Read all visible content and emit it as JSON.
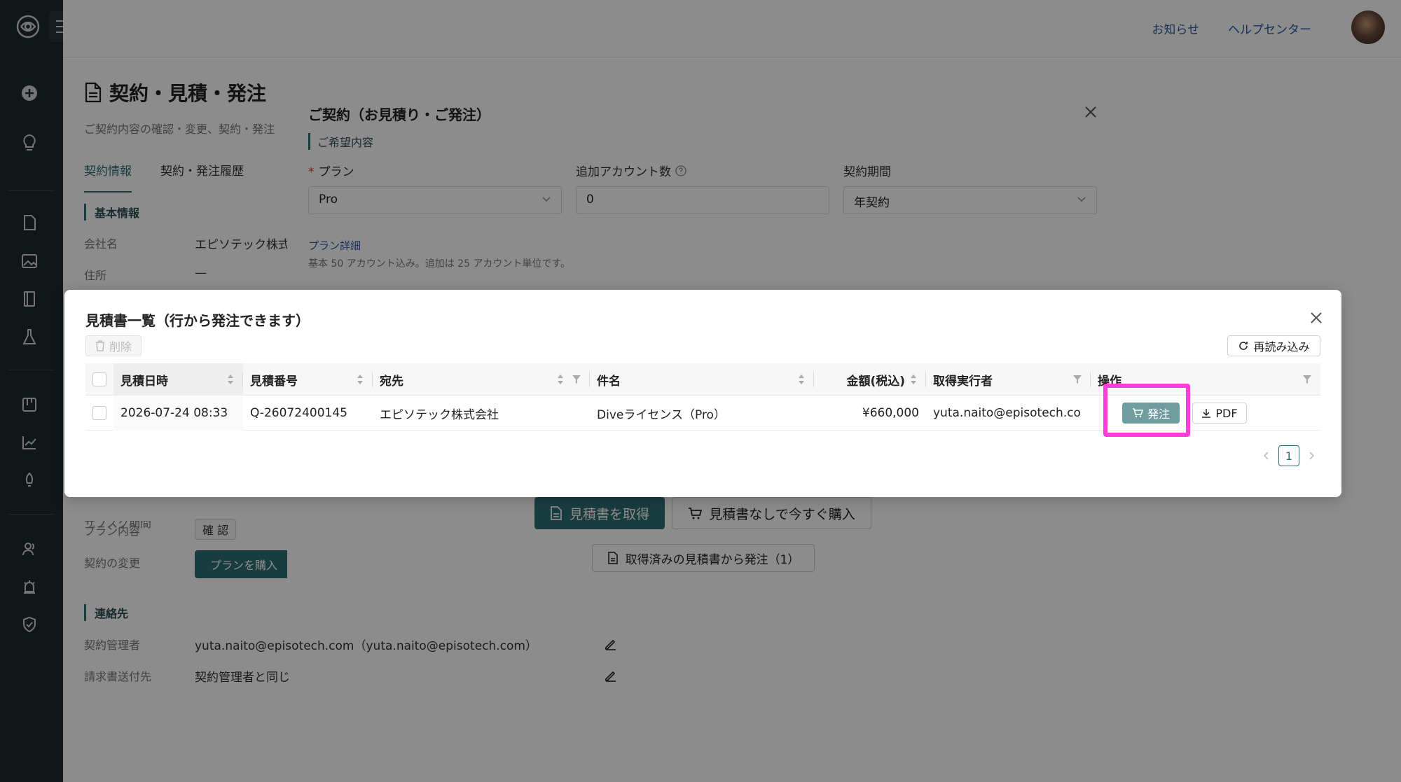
{
  "topbar": {
    "news_label": "お知らせ",
    "help_label": "ヘルプセンター"
  },
  "page": {
    "title": "契約・見積・発注",
    "subtitle": "ご契約内容の確認・変更、契約・発注",
    "tabs": [
      "契約情報",
      "契約・発注履歴"
    ],
    "basic_section": "基本情報",
    "company_label": "会社名",
    "company_value": "エピソテック株式",
    "address_label": "住所",
    "address_value": "—",
    "period_label": "サブスク期間",
    "plan_content_label": "プラン内容",
    "plan_content_value": "確 認",
    "change_label": "契約の変更",
    "buy_plan_label": "プランを購入",
    "contact_section": "連絡先",
    "manager_label": "契約管理者",
    "manager_value": "yuta.naito@episotech.com（yuta.naito@episotech.com）",
    "billing_label": "請求書送付先",
    "billing_value": "契約管理者と同じ"
  },
  "contract_modal": {
    "title": "ご契約（お見積り・ご発注）",
    "section": "ご希望内容",
    "plan_label": "プラン",
    "plan_required": "*",
    "plan_value": "Pro",
    "accounts_label": "追加アカウント数",
    "accounts_value": "0",
    "period_label": "契約期間",
    "period_value": "年契約",
    "plan_detail_link": "プラン詳細",
    "plan_note": "基本 50 アカウント込み。追加は 25 アカウント単位です。",
    "get_estimate_label": "見積書を取得",
    "buy_now_label": "見積書なしで今すぐ購入",
    "order_from_estimate_label": "取得済みの見積書から発注（1）"
  },
  "estimate_modal": {
    "title": "見積書一覧（行から発注できます）",
    "delete_label": "削除",
    "reload_label": "再読み込み",
    "columns": [
      "見積日時",
      "見積番号",
      "宛先",
      "件名",
      "金額(税込)",
      "取得実行者",
      "操作"
    ],
    "rows": [
      {
        "date": "2026-07-24 08:33",
        "number": "Q-26072400145",
        "recipient": "エピソテック株式会社",
        "subject": "Diveライセンス（Pro）",
        "amount": "¥660,000",
        "requester": "yuta.naito@episotech.com",
        "order_label": "発注",
        "pdf_label": "PDF"
      }
    ],
    "page_number": "1"
  },
  "colors": {
    "accent": "#2e6e74",
    "highlight": "#ff3dd9",
    "link": "#2b5cab"
  }
}
